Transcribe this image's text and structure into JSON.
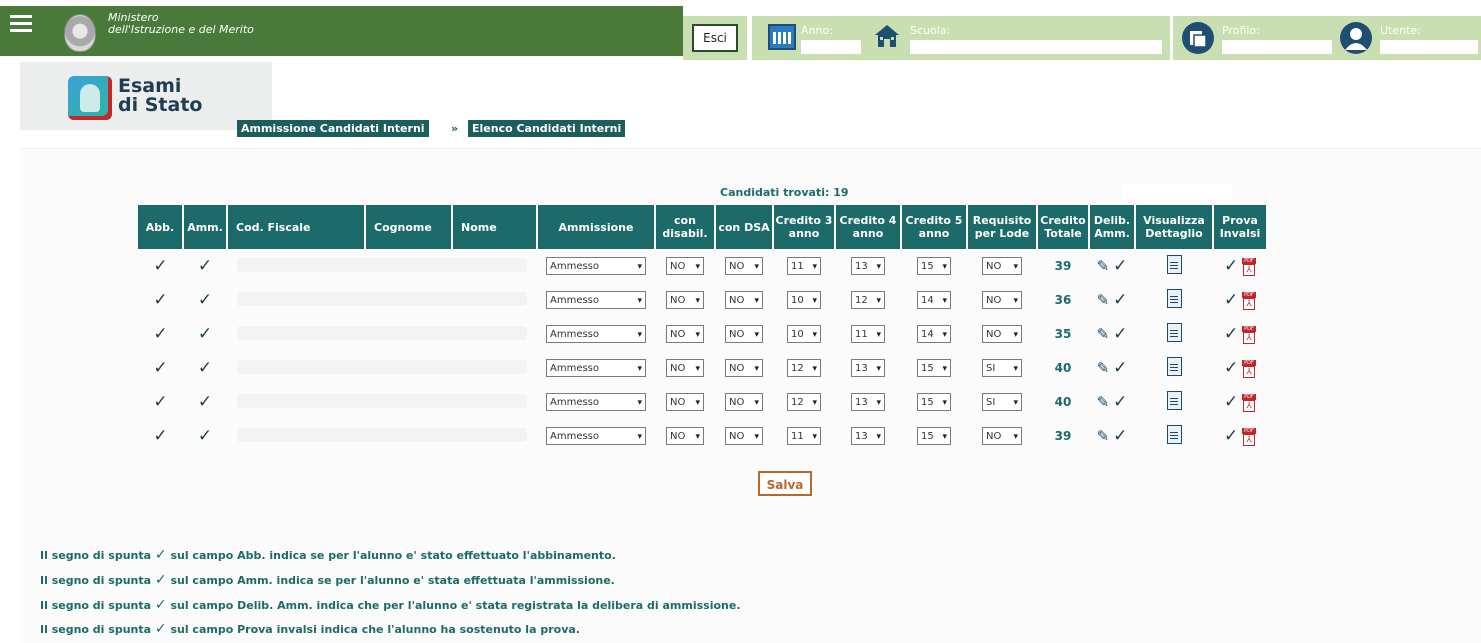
{
  "header": {
    "ministry_line1": "Ministero",
    "ministry_line2": "dell'Istruzione e del Merito",
    "exit_label": "Esci",
    "anno_label": "Anno:",
    "scuola_label": "Scuola:",
    "profilo_label": "Profilo:",
    "utente_label": "Utente:"
  },
  "brand": {
    "line1": "Esami",
    "line2": "di Stato"
  },
  "breadcrumb": [
    "Ammissione Candidati Interni",
    "»",
    "Elenco Candidati Interni"
  ],
  "found_text": "Candidati trovati: 19",
  "columns": {
    "abb": "Abb.",
    "amm": "Amm.",
    "cf": "Cod. Fiscale",
    "cognome": "Cognome",
    "nome": "Nome",
    "ammissione": "Ammissione",
    "disabil": "con disabil.",
    "dsa": "con DSA",
    "c3": "Credito 3 anno",
    "c4": "Credito 4 anno",
    "c5": "Credito 5 anno",
    "lode": "Requisito per Lode",
    "tot": "Credito Totale",
    "delib": "Delib. Amm.",
    "dett": "Visualizza Dettaglio",
    "invalsi": "Prova Invalsi"
  },
  "rows": [
    {
      "ammissione": "Ammesso",
      "disabil": "NO",
      "dsa": "NO",
      "c3": "11",
      "c4": "13",
      "c5": "15",
      "lode": "NO",
      "tot": "39"
    },
    {
      "ammissione": "Ammesso",
      "disabil": "NO",
      "dsa": "NO",
      "c3": "10",
      "c4": "12",
      "c5": "14",
      "lode": "NO",
      "tot": "36"
    },
    {
      "ammissione": "Ammesso",
      "disabil": "NO",
      "dsa": "NO",
      "c3": "10",
      "c4": "11",
      "c5": "14",
      "lode": "NO",
      "tot": "35"
    },
    {
      "ammissione": "Ammesso",
      "disabil": "NO",
      "dsa": "NO",
      "c3": "12",
      "c4": "13",
      "c5": "15",
      "lode": "SI",
      "tot": "40"
    },
    {
      "ammissione": "Ammesso",
      "disabil": "NO",
      "dsa": "NO",
      "c3": "12",
      "c4": "13",
      "c5": "15",
      "lode": "SI",
      "tot": "40"
    },
    {
      "ammissione": "Ammesso",
      "disabil": "NO",
      "dsa": "NO",
      "c3": "11",
      "c4": "13",
      "c5": "15",
      "lode": "NO",
      "tot": "39"
    }
  ],
  "symbols": {
    "check": "✓",
    "dropdown_arrow": "▾",
    "pdf_tag": "PDF",
    "pdf_glyph": "⅄",
    "edit": "✎"
  },
  "save_label": "Salva",
  "notes": [
    {
      "pre": "Il segno di spunta",
      "post": "sul campo Abb. indica se per l'alunno e' stato effettuato l'abbinamento."
    },
    {
      "pre": "Il segno di spunta",
      "post": "sul campo Amm. indica se per l'alunno e' stata effettuata l'ammissione."
    },
    {
      "pre": "Il segno di spunta",
      "post": "sul campo Delib. Amm. indica che per l'alunno e' stata registrata la delibera di ammissione."
    },
    {
      "pre": "Il segno di spunta",
      "post": "sul campo Prova invalsi indica che l'alunno ha sostenuto la prova."
    }
  ],
  "colors": {
    "header_green": "#4a7a3a",
    "teal": "#1c6a6a",
    "light_green": "#c9dfb2",
    "save_border": "#b9672a"
  },
  "icons": [
    "menu-icon",
    "emblem-icon",
    "calendar-icon",
    "school-icon",
    "profile-icon",
    "user-icon",
    "check-icon",
    "edit-icon",
    "document-icon",
    "pdf-icon"
  ]
}
